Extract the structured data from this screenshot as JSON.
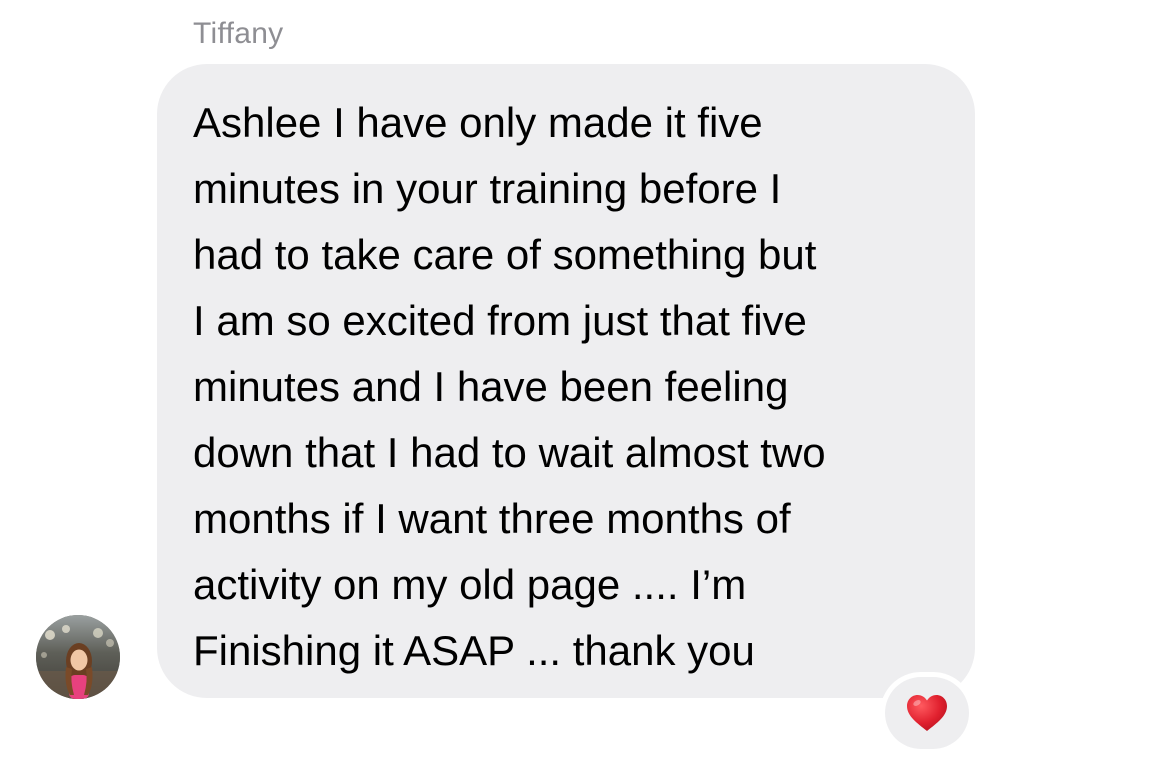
{
  "message": {
    "sender_name": "Tiffany",
    "text_lines": [
      "Ashlee I have only made it five",
      "minutes in your training before I",
      "had to take care of something but",
      "I am so excited from just that five",
      "minutes and I have been feeling",
      "down that I had to wait almost two",
      "months if I want three months of",
      "activity on my old page .... I’m",
      "Finishing it ASAP ... thank you"
    ],
    "reaction": "heart-icon",
    "avatar": "profile-photo"
  },
  "colors": {
    "bubble": "#eeeef0",
    "sender_name": "#8e8e93",
    "text": "#000000",
    "heart": "#e0202e"
  }
}
